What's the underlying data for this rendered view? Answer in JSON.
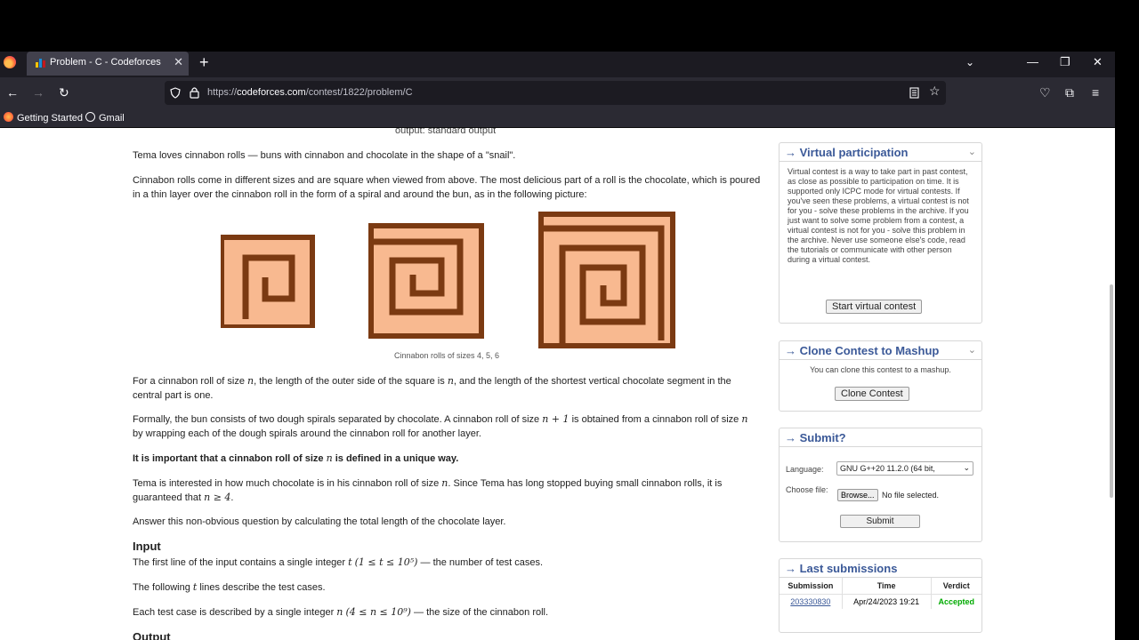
{
  "browser": {
    "tab_title": "Problem - C - Codeforces",
    "url_prefix": "https://",
    "url_domain": "codeforces.com",
    "url_path": "/contest/1822/problem/C",
    "bookmarks": [
      "Getting Started",
      "Gmail"
    ]
  },
  "problem": {
    "output_line": "output: standard output",
    "p1": "Tema loves cinnabon rolls — buns with cinnabon and chocolate in the shape of a \"snail\".",
    "p2": "Cinnabon rolls come in different sizes and are square when viewed from above. The most delicious part of a roll is the chocolate, which is poured in a thin layer over the cinnabon roll in the form of a spiral and around the bun, as in the following picture:",
    "caption": "Cinnabon rolls of sizes 4, 5, 6",
    "p3a": "For a cinnabon roll of size ",
    "p3b": ", the length of the outer side of the square is ",
    "p3c": ", and the length of the shortest vertical chocolate segment in the central part is one.",
    "p4a": "Formally, the bun consists of two dough spirals separated by chocolate. A cinnabon roll of size ",
    "p4b": " is obtained from a cinnabon roll of size ",
    "p4c": " by wrapping each of the dough spirals around the cinnabon roll for another layer.",
    "p5a": "It is important that a cinnabon roll of size ",
    "p5b": " is defined in a unique way.",
    "p6a": "Tema is interested in how much chocolate is in his cinnabon roll of size ",
    "p6b": ". Since Tema has long stopped buying small cinnabon rolls, it is guaranteed that ",
    "p6c": ".",
    "p7": "Answer this non-obvious question by calculating the total length of the chocolate layer.",
    "input_heading": "Input",
    "i1a": "The first line of the input contains a single integer ",
    "i1b": " — the number of test cases.",
    "i2a": "The following ",
    "i2b": " lines describe the test cases.",
    "i3a": "Each test case is described by a single integer ",
    "i3b": " — the size of the cinnabon roll.",
    "output_heading": "Output",
    "m_n": "n",
    "m_n1": "n + 1",
    "m_nge4": "n ≥ 4",
    "m_t": "t",
    "m_trange": "(1 ≤ t ≤ 10⁵)",
    "m_nrange": "(4 ≤ n ≤ 10⁹)"
  },
  "sidebar": {
    "virtual": {
      "title": "→ Virtual participation",
      "text": "Virtual contest is a way to take part in past contest, as close as possible to participation on time. It is supported only ICPC mode for virtual contests. If you've seen these problems, a virtual contest is not for you - solve these problems in the archive. If you just want to solve some problem from a contest, a virtual contest is not for you - solve this problem in the archive. Never use someone else's code, read the tutorials or communicate with other person during a virtual contest.",
      "button": "Start virtual contest"
    },
    "clone": {
      "title": "→ Clone Contest to Mashup",
      "text": "You can clone this contest to a mashup.",
      "button": "Clone Contest"
    },
    "submit": {
      "title": "→ Submit?",
      "language_label": "Language:",
      "language_value": "GNU G++20 11.2.0 (64 bit,",
      "file_label": "Choose file:",
      "browse": "Browse...",
      "no_file": "No file selected.",
      "button": "Submit"
    },
    "last": {
      "title": "→ Last submissions",
      "headers": [
        "Submission",
        "Time",
        "Verdict"
      ],
      "rows": [
        {
          "id": "203330830",
          "time": "Apr/24/2023 19:21",
          "verdict": "Accepted"
        }
      ]
    }
  },
  "colors": {
    "chocolate": "#7b3a12",
    "dough": "#f8b990",
    "link": "#3b5998",
    "accepted": "#0a0"
  }
}
